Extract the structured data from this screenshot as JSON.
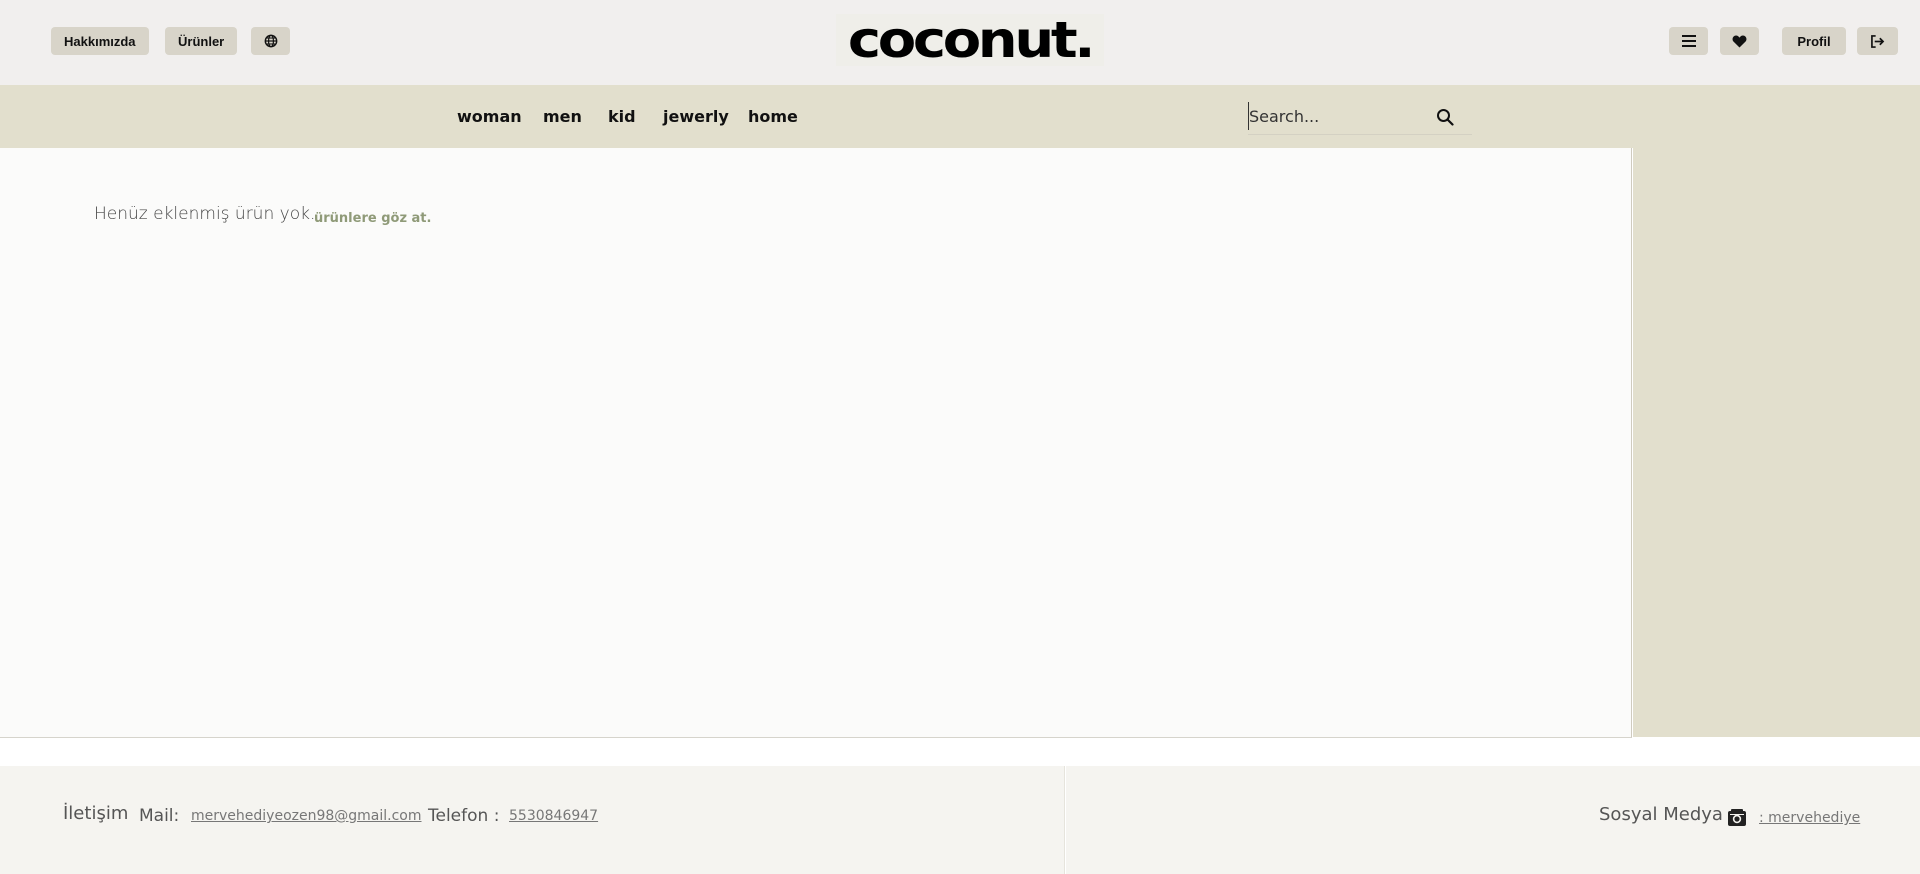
{
  "header": {
    "about_label": "Hakkımızda",
    "products_label": "Ürünler",
    "globe_icon": "globe-icon",
    "logo_text": "coconut.",
    "menu_icon": "hamburger-menu-icon",
    "favorites_icon": "heart-icon",
    "profile_label": "Profil",
    "logout_icon": "sign-out-icon"
  },
  "categories": [
    "woman",
    "men",
    "kid",
    "jewerly",
    "home"
  ],
  "search": {
    "placeholder": "Search...",
    "icon": "search-icon"
  },
  "main": {
    "empty_message": "Henüz eklenmiş ürün yok.",
    "browse_link": "ürünlere göz at."
  },
  "footer": {
    "contact_title": "İletişim",
    "mail_label": "Mail:",
    "mail_value": "mervehediyeozen98@gmail.com",
    "phone_label": "Telefon :",
    "phone_value": "5530846947",
    "social_title": "Sosyal Medya",
    "instagram_icon": "instagram-icon",
    "instagram_handle": ": mervehediye"
  },
  "colors": {
    "topbar_bg": "#f1efee",
    "category_bar_bg": "#e2dfcd",
    "pill_bg": "#d8d4c9",
    "link_green": "#8f9a78",
    "footer_bg": "#f5f4f0"
  }
}
